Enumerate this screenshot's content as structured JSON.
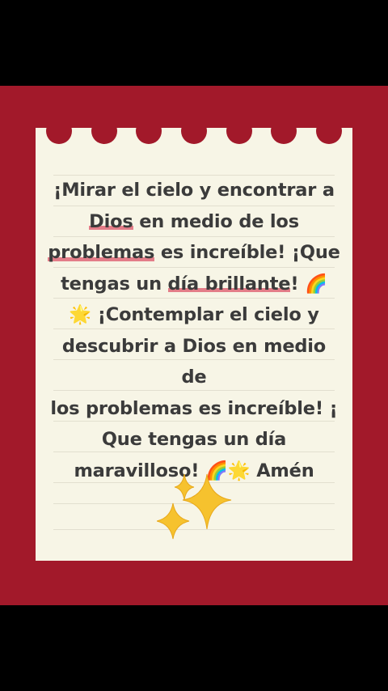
{
  "note": {
    "line1": "¡Mirar el cielo y encontrar a",
    "line2_hl": "Dios",
    "line2_rest": " en medio de los",
    "line3_hl": "problemas",
    "line3_rest": " es increíble! ¡Que",
    "line4_a": "tengas un ",
    "line4_hl1": "día",
    "line4_sp": " ",
    "line4_hl2": "brillante",
    "line4_end": "! 🌈",
    "line5": "🌟 ¡Contemplar el cielo y",
    "line6": "descubrir a Dios en medio de",
    "line7": "los problemas es increíble! ¡",
    "line8": "Que tengas un día",
    "line9": "maravilloso! 🌈🌟 Amén",
    "decoration_icon": "sparkles-icon"
  },
  "colors": {
    "background_red": "#a2192a",
    "paper": "#f7f5e6",
    "text": "#3b3b3b",
    "highlight": "#e37d88",
    "sparkle": "#f6c22e"
  }
}
